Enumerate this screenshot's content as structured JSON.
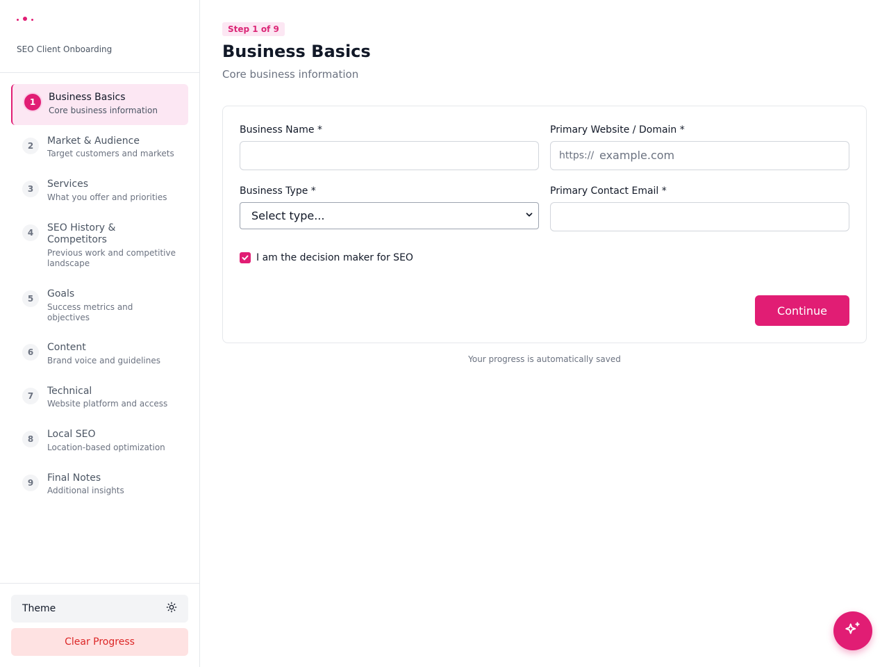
{
  "app": {
    "subtitle": "SEO Client Onboarding"
  },
  "sidebar": {
    "steps": [
      {
        "num": "1",
        "title": "Business Basics",
        "desc": "Core business information",
        "active": true
      },
      {
        "num": "2",
        "title": "Market & Audience",
        "desc": "Target customers and markets"
      },
      {
        "num": "3",
        "title": "Services",
        "desc": "What you offer and priorities"
      },
      {
        "num": "4",
        "title": "SEO History &",
        "title2": "Competitors",
        "desc": "Previous work and competitive",
        "desc2": "landscape"
      },
      {
        "num": "5",
        "title": "Goals",
        "desc": "Success metrics and",
        "desc2": "objectives"
      },
      {
        "num": "6",
        "title": "Content",
        "desc": "Brand voice and guidelines"
      },
      {
        "num": "7",
        "title": "Technical",
        "desc": "Website platform and access"
      },
      {
        "num": "8",
        "title": "Local SEO",
        "desc": "Location-based optimization"
      },
      {
        "num": "9",
        "title": "Final Notes",
        "desc": "Additional insights"
      }
    ],
    "theme_label": "Theme",
    "clear_label": "Clear Progress"
  },
  "main": {
    "step_badge": "Step 1 of 9",
    "title": "Business Basics",
    "subtitle": "Core business information",
    "form": {
      "business_name_label": "Business Name *",
      "business_name_value": "",
      "website_label": "Primary Website / Domain *",
      "website_prefix": "https://",
      "website_placeholder": "example.com",
      "business_type_label": "Business Type *",
      "business_type_value": "Select type...",
      "email_label": "Primary Contact Email *",
      "email_value": "",
      "decision_maker_label": "I am the decision maker for SEO",
      "decision_maker_checked": true,
      "continue_label": "Continue"
    },
    "saved_note": "Your progress is automatically saved"
  },
  "colors": {
    "accent": "#e11d74",
    "accent_light": "#fce7f3",
    "danger_bg": "#fee2e2",
    "danger_text": "#dc2626"
  },
  "icons": {
    "logo": "dots-logo-icon",
    "theme": "sun-icon",
    "fab": "sparkles-icon",
    "select": "chevron-down-icon",
    "checkbox": "check-icon"
  }
}
